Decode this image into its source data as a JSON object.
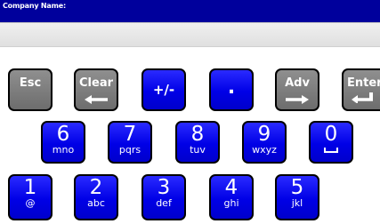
{
  "header": {
    "label": "Company Name:"
  },
  "input": {
    "value": ""
  },
  "keys": {
    "esc": "Esc",
    "clear": "Clear",
    "plus_minus": "+/-",
    "dot": ".",
    "adv": "Adv",
    "enter": "Enter",
    "k6": {
      "digit": "6",
      "letters": "mno"
    },
    "k7": {
      "digit": "7",
      "letters": "pqrs"
    },
    "k8": {
      "digit": "8",
      "letters": "tuv"
    },
    "k9": {
      "digit": "9",
      "letters": "wxyz"
    },
    "k0": {
      "digit": "0"
    },
    "k1": {
      "digit": "1",
      "letters": "@"
    },
    "k2": {
      "digit": "2",
      "letters": "abc"
    },
    "k3": {
      "digit": "3",
      "letters": "def"
    },
    "k4": {
      "digit": "4",
      "letters": "ghi"
    },
    "k5": {
      "digit": "5",
      "letters": "jkl"
    }
  },
  "colors": {
    "header_bg": "#00009c",
    "key_blue": "#0000e6",
    "key_gray": "#7a7a7a"
  },
  "icons": {
    "clear": "left-arrow-icon",
    "adv": "right-arrow-icon",
    "enter": "enter-arrow-icon",
    "space": "space-icon"
  }
}
